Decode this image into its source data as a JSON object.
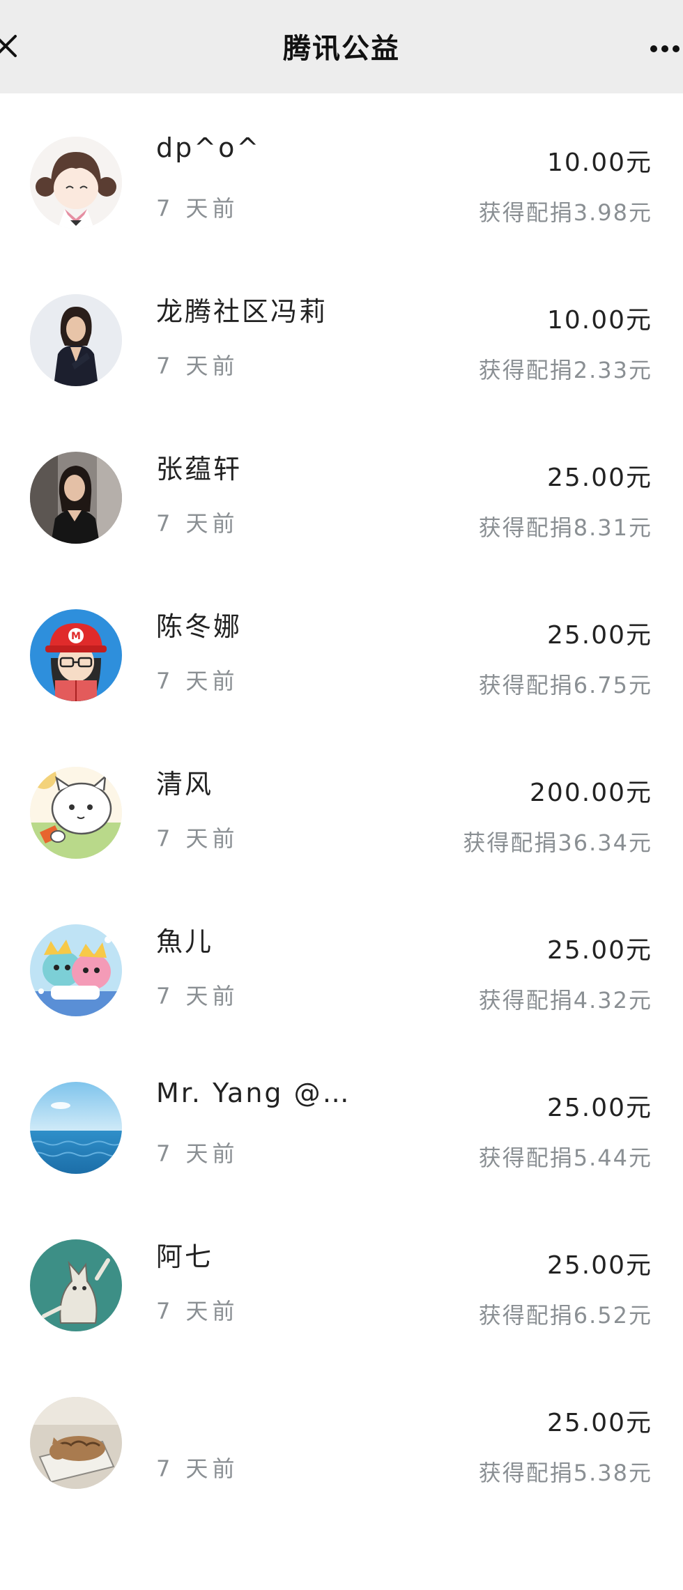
{
  "header": {
    "title": "腾讯公益",
    "close_icon": "close-icon",
    "more_icon": "more-dots-icon"
  },
  "donations": [
    {
      "name": "dp^o^",
      "time": "7 天前",
      "amount": "10.00元",
      "match": "获得配捐3.98元",
      "avatar": "cartoon-girl-avatar"
    },
    {
      "name": "龙腾社区冯莉",
      "time": "7 天前",
      "amount": "10.00元",
      "match": "获得配捐2.33元",
      "avatar": "woman-suit-photo-avatar"
    },
    {
      "name": "张蕴轩",
      "time": "7 天前",
      "amount": "25.00元",
      "match": "获得配捐8.31元",
      "avatar": "woman-photo-avatar"
    },
    {
      "name": "陈冬娜",
      "time": "7 天前",
      "amount": "25.00元",
      "match": "获得配捐6.75元",
      "avatar": "cartoon-red-cap-avatar"
    },
    {
      "name": "清风",
      "time": "7 天前",
      "amount": "200.00元",
      "match": "获得配捐36.34元",
      "avatar": "cartoon-cat-avatar"
    },
    {
      "name": "魚儿",
      "time": "7 天前",
      "amount": "25.00元",
      "match": "获得配捐4.32元",
      "avatar": "cartoon-colorful-avatar"
    },
    {
      "name": "Mr. Yang @…",
      "time": "7 天前",
      "amount": "25.00元",
      "match": "获得配捐5.44元",
      "avatar": "ocean-sky-avatar"
    },
    {
      "name": "阿七",
      "time": "7 天前",
      "amount": "25.00元",
      "match": "获得配捐6.52元",
      "avatar": "sketch-cat-avatar"
    },
    {
      "name": "",
      "time": "7 天前",
      "amount": "25.00元",
      "match": "获得配捐5.38元",
      "avatar": "sleeping-cat-photo-avatar"
    }
  ]
}
